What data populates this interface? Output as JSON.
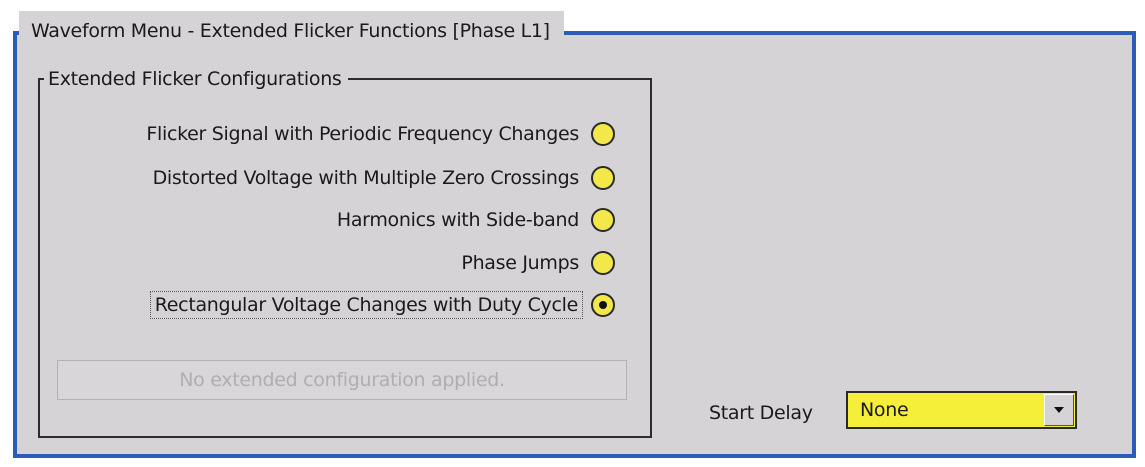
{
  "window": {
    "title": "Waveform Menu - Extended Flicker Functions [Phase L1]"
  },
  "group": {
    "title": "Extended Flicker Configurations",
    "options": [
      {
        "label": "Flicker Signal with Periodic Frequency Changes",
        "selected": false
      },
      {
        "label": "Distorted Voltage with Multiple Zero Crossings",
        "selected": false
      },
      {
        "label": "Harmonics with Side-band",
        "selected": false
      },
      {
        "label": "Phase Jumps",
        "selected": false
      },
      {
        "label": "Rectangular Voltage Changes with Duty Cycle",
        "selected": true
      }
    ],
    "status_text": "No extended configuration applied."
  },
  "start_delay": {
    "label": "Start Delay",
    "value": "None"
  },
  "colors": {
    "panel_bg": "#d6d3d6",
    "border_blue": "#2a5cb8",
    "radio_yellow": "#f2e84a",
    "select_yellow": "#f6ef3a"
  },
  "icons": {
    "radio": "radio-button-icon",
    "dropdown": "dropdown-arrow-icon"
  }
}
